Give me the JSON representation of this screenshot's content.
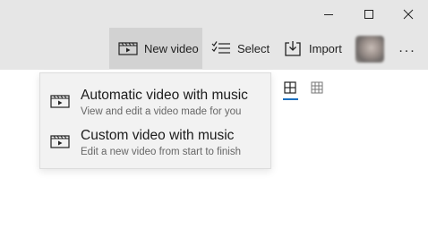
{
  "window_controls": [
    "minimize-icon",
    "maximize-icon",
    "close-icon"
  ],
  "toolbar": {
    "new_video_label": "New video",
    "select_label": "Select",
    "import_label": "Import",
    "more_label": "..."
  },
  "dropdown": {
    "items": [
      {
        "title": "Automatic video with music",
        "subtitle": "View and edit a video made for you",
        "icon": "video-icon"
      },
      {
        "title": "Custom video with music",
        "subtitle": "Edit a new video from start to finish",
        "icon": "video-icon"
      }
    ]
  },
  "view_options": [
    {
      "icon": "large-grid-icon",
      "selected": true
    },
    {
      "icon": "small-grid-icon",
      "selected": false
    }
  ],
  "colors": {
    "accent": "#1a6fbf",
    "toolbar_bg": "#e6e6e6",
    "active_button_bg": "#d2d2d2",
    "menu_bg": "#f2f2f2"
  }
}
